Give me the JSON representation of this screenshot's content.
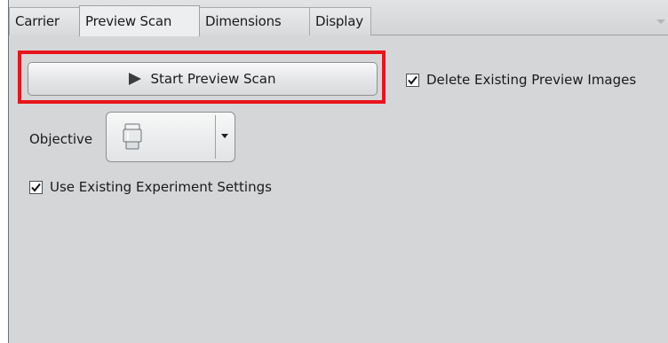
{
  "tabs": [
    {
      "label": "Carrier",
      "active": false
    },
    {
      "label": "Preview Scan",
      "active": true
    },
    {
      "label": "Dimensions",
      "active": false
    },
    {
      "label": "Display",
      "active": false
    }
  ],
  "start_button": {
    "label": "Start Preview Scan",
    "icon": "play-icon"
  },
  "delete_images": {
    "label": "Delete Existing Preview Images",
    "checked": true
  },
  "objective": {
    "label": "Objective",
    "icon": "objective-lens-icon",
    "dropdown_icon": "chevron-down-icon"
  },
  "use_existing": {
    "label": "Use Existing Experiment Settings",
    "checked": true
  },
  "colors": {
    "highlight": "#e8141b",
    "panel": "#d4d6d8"
  }
}
